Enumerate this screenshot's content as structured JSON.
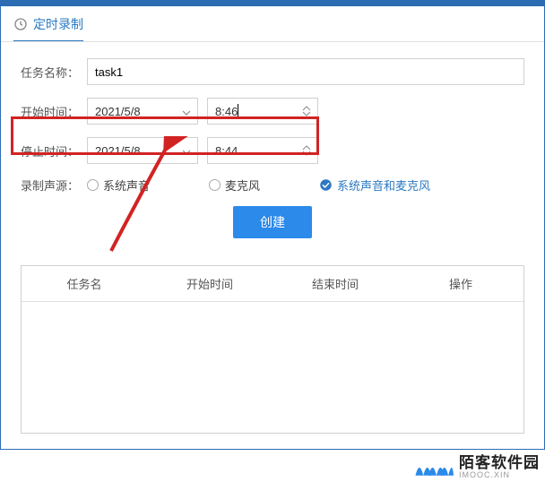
{
  "header": {
    "title": "定时录制"
  },
  "form": {
    "task_name_label": "任务名称：",
    "task_name_value": "task1",
    "start_time_label": "开始时间：",
    "start_date_value": "2021/5/8",
    "start_time_value": "8:46",
    "stop_time_label": "停止时间：",
    "stop_date_value": "2021/5/8",
    "stop_time_value": "8:44",
    "audio_source_label": "录制声源：",
    "audio_options": {
      "system": "系统声音",
      "mic": "麦克风",
      "both": "系统声音和麦克风"
    },
    "audio_selected": "both",
    "create_button": "创建"
  },
  "table": {
    "columns": [
      "任务名",
      "开始时间",
      "结束时间",
      "操作"
    ]
  },
  "watermark": {
    "cn": "陌客软件园",
    "en": "IMOOC.XIN"
  }
}
